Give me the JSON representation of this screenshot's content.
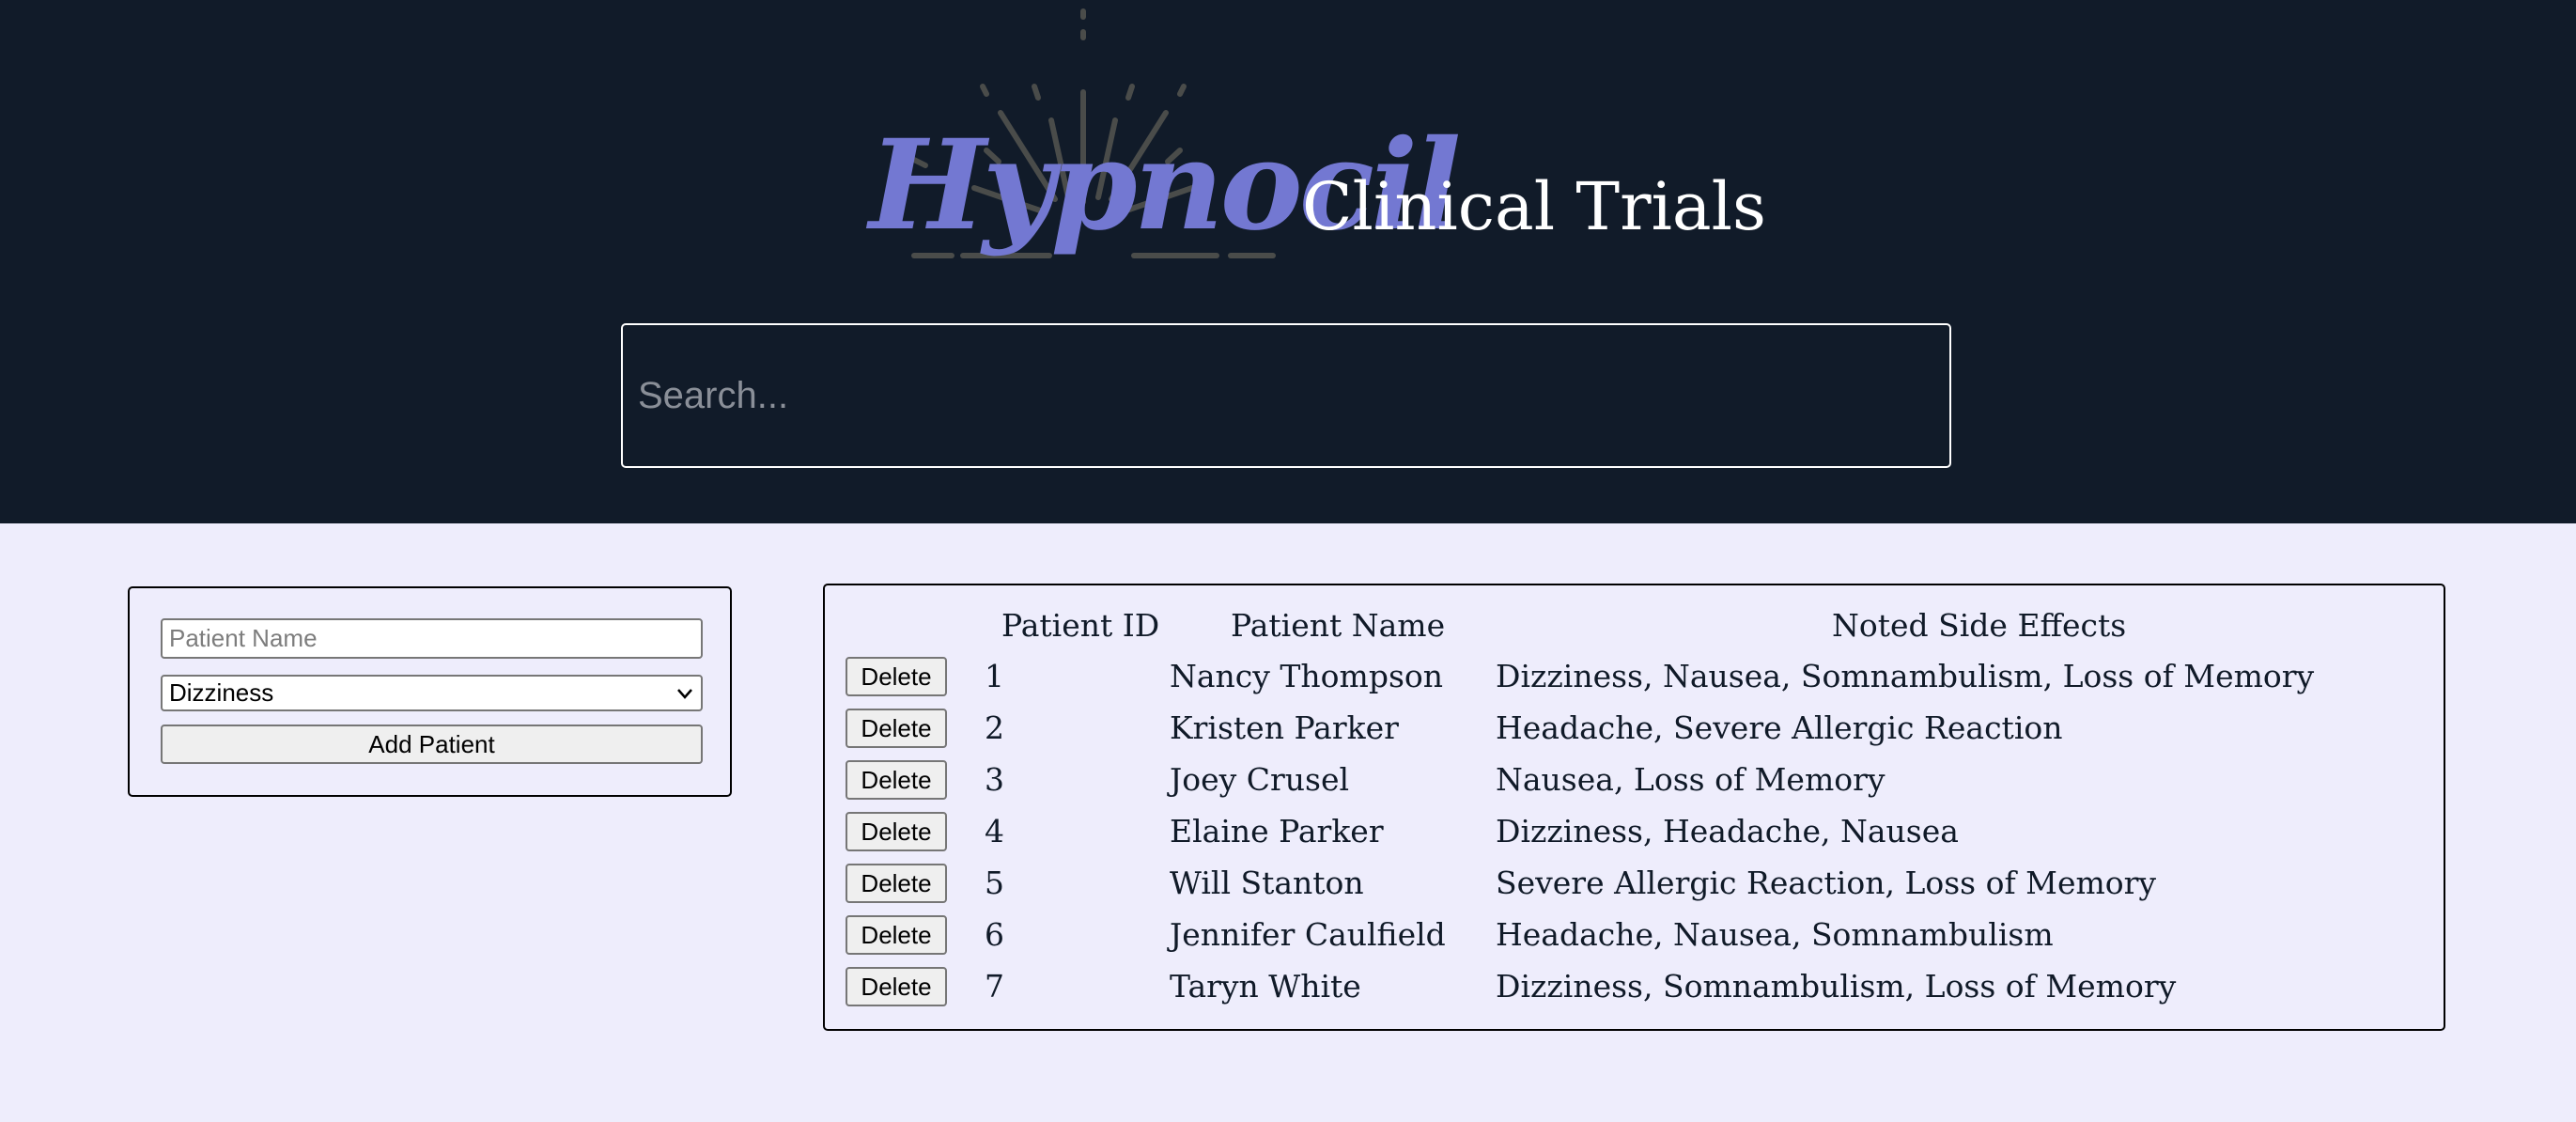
{
  "header": {
    "logo_text": "Hypnocil",
    "title": "Clinical Trials",
    "search_placeholder": "Search..."
  },
  "form": {
    "name_placeholder": "Patient Name",
    "side_effect_selected": "Dizziness",
    "add_label": "Add Patient"
  },
  "table": {
    "headers": [
      "Patient ID",
      "Patient Name",
      "Noted Side Effects"
    ],
    "delete_label": "Delete",
    "rows": [
      {
        "id": "1",
        "name": "Nancy Thompson",
        "effects": "Dizziness, Nausea, Somnambulism, Loss of Memory"
      },
      {
        "id": "2",
        "name": "Kristen Parker",
        "effects": "Headache, Severe Allergic Reaction"
      },
      {
        "id": "3",
        "name": "Joey Crusel",
        "effects": "Nausea, Loss of Memory"
      },
      {
        "id": "4",
        "name": "Elaine Parker",
        "effects": "Dizziness, Headache, Nausea"
      },
      {
        "id": "5",
        "name": "Will Stanton",
        "effects": "Severe Allergic Reaction, Loss of Memory"
      },
      {
        "id": "6",
        "name": "Jennifer Caulfield",
        "effects": "Headache, Nausea, Somnambulism"
      },
      {
        "id": "7",
        "name": "Taryn White",
        "effects": "Dizziness, Somnambulism, Loss of Memory"
      }
    ]
  },
  "colors": {
    "header_bg": "#111b29",
    "page_bg": "#eeedfc",
    "logo": "#7378d2",
    "rays": "#4a4c4a"
  }
}
